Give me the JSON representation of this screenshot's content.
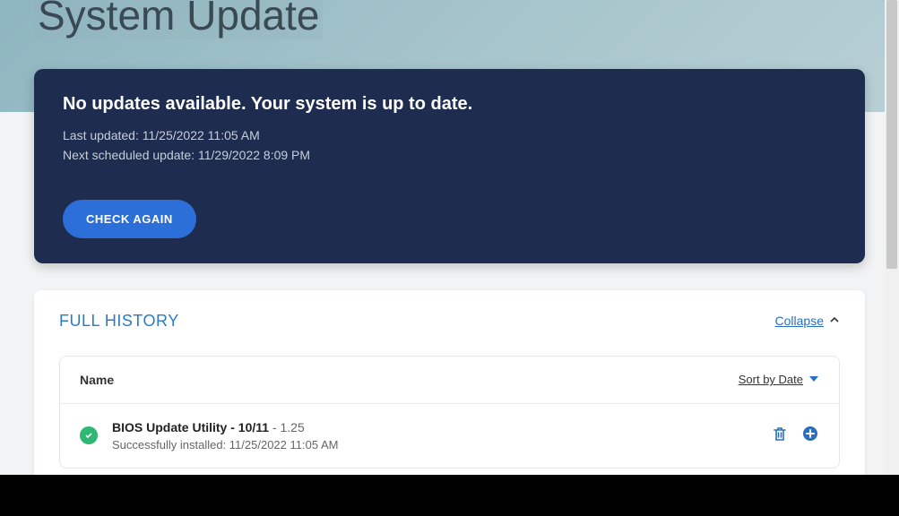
{
  "page": {
    "title": "System Update"
  },
  "status": {
    "headline": "No updates available. Your system is up to date.",
    "lastUpdated": "Last updated: 11/25/2022 11:05 AM",
    "nextScheduled": "Next scheduled update: 11/29/2022 8:09 PM",
    "checkAgain": "CHECK AGAIN"
  },
  "history": {
    "title": "FULL HISTORY",
    "collapse": "Collapse",
    "columns": {
      "name": "Name"
    },
    "sortBy": "Sort by Date ",
    "items": [
      {
        "title": "BIOS Update Utility - 10/11",
        "version": " - 1.25",
        "status": "Successfully installed: 11/25/2022 11:05 AM"
      }
    ]
  }
}
